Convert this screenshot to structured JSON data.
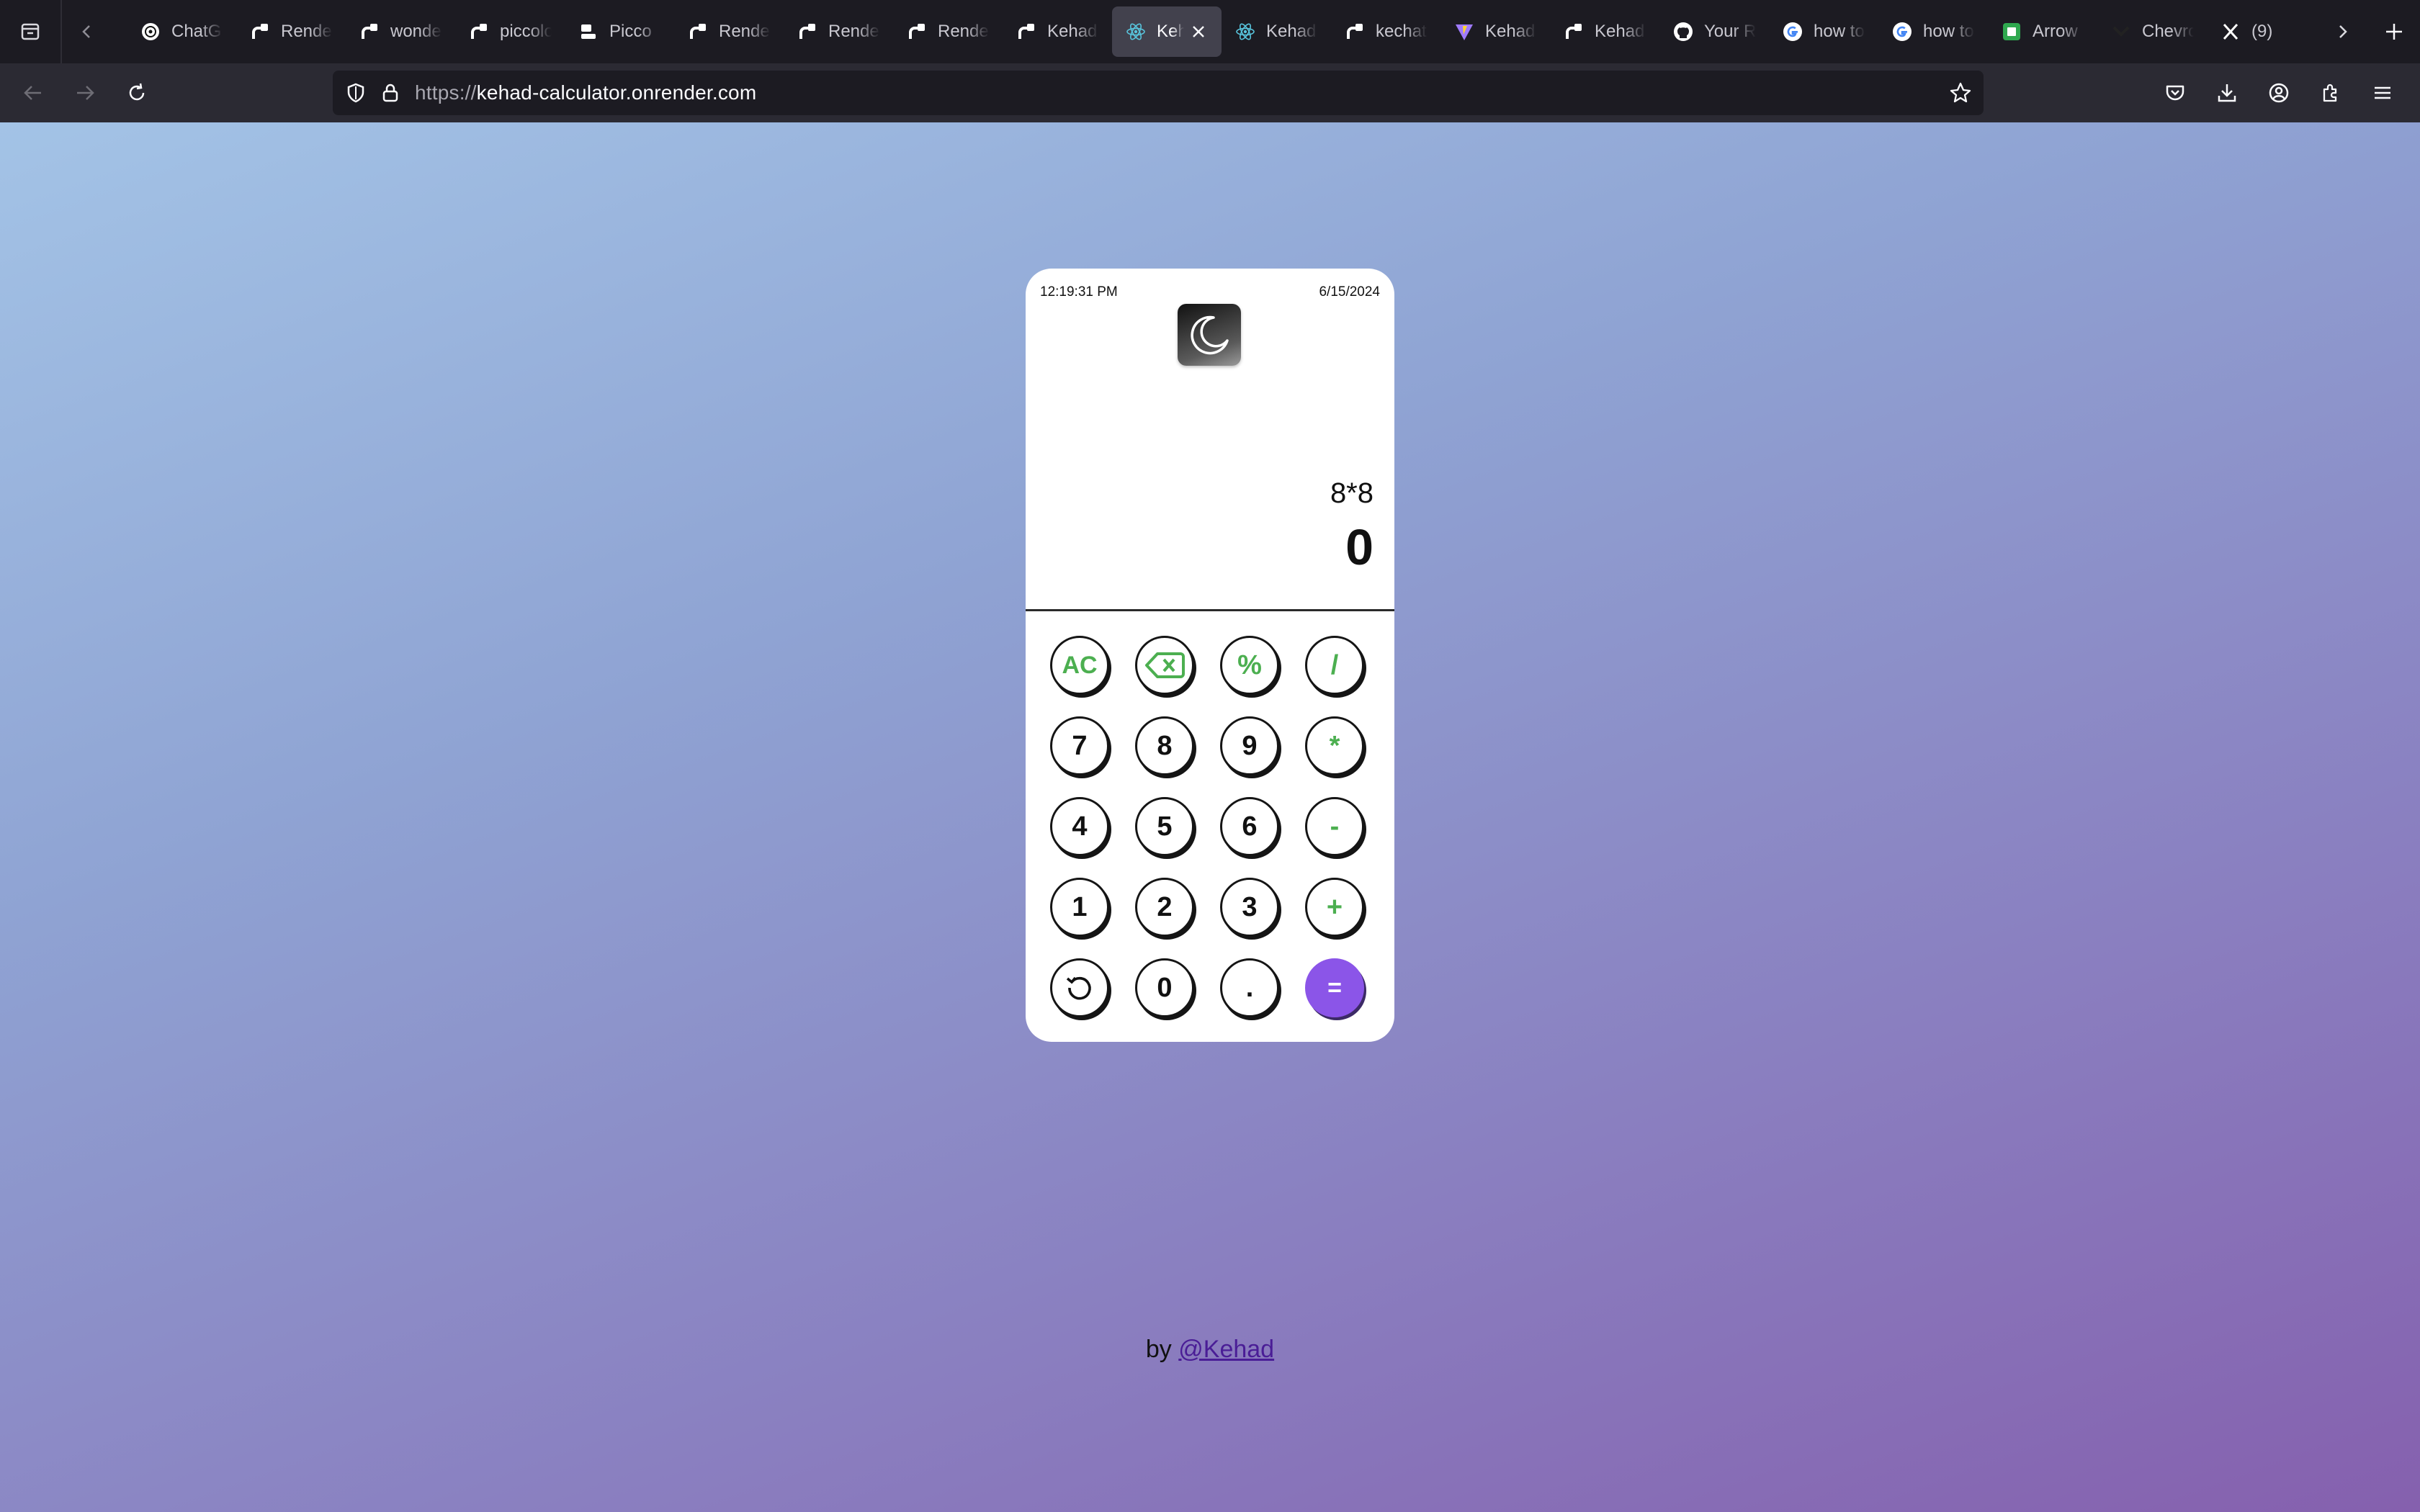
{
  "browser": {
    "tabs": [
      {
        "title": "ChatGPT",
        "icon": "openai-icon"
      },
      {
        "title": "Render",
        "icon": "render-icon"
      },
      {
        "title": "wonderful",
        "icon": "render-icon"
      },
      {
        "title": "piccolo",
        "icon": "render-icon"
      },
      {
        "title": "Picco",
        "icon": "picco-icon"
      },
      {
        "title": "Render",
        "icon": "render-icon"
      },
      {
        "title": "Render",
        "icon": "render-icon"
      },
      {
        "title": "Render",
        "icon": "render-icon"
      },
      {
        "title": "Kehad",
        "icon": "render-icon"
      },
      {
        "title": "Kehad",
        "icon": "react-icon",
        "active": true
      },
      {
        "title": "Kehad",
        "icon": "react-icon"
      },
      {
        "title": "kechat",
        "icon": "render-icon"
      },
      {
        "title": "Kehad",
        "icon": "vite-icon"
      },
      {
        "title": "Kehad",
        "icon": "render-icon"
      },
      {
        "title": "Your R",
        "icon": "github-icon"
      },
      {
        "title": "how to",
        "icon": "google-icon"
      },
      {
        "title": "how to",
        "icon": "google-icon"
      },
      {
        "title": "Arrow",
        "icon": "green-square-icon"
      },
      {
        "title": "Chevron",
        "icon": "vercel-icon"
      },
      {
        "title": "(9)",
        "icon": "x-icon"
      }
    ],
    "url_protocol": "https://",
    "url_host": "kehad-calculator.onrender.com"
  },
  "calculator": {
    "time": "12:19:31 PM",
    "date": "6/15/2024",
    "expression": "8*8",
    "result": "0",
    "keys": [
      [
        {
          "label": "AC",
          "type": "fn"
        },
        {
          "label": "",
          "type": "fn",
          "icon": "backspace-icon"
        },
        {
          "label": "%",
          "type": "fn"
        },
        {
          "label": "/",
          "type": "fn"
        }
      ],
      [
        {
          "label": "7"
        },
        {
          "label": "8"
        },
        {
          "label": "9"
        },
        {
          "label": "*",
          "type": "fn"
        }
      ],
      [
        {
          "label": "4"
        },
        {
          "label": "5"
        },
        {
          "label": "6"
        },
        {
          "label": "-",
          "type": "fn"
        }
      ],
      [
        {
          "label": "1"
        },
        {
          "label": "2"
        },
        {
          "label": "3"
        },
        {
          "label": "+",
          "type": "fn"
        }
      ],
      [
        {
          "label": "",
          "icon": "history-icon"
        },
        {
          "label": "0"
        },
        {
          "label": "."
        },
        {
          "label": "=",
          "type": "eq"
        }
      ]
    ],
    "accent_color": "#4caf50",
    "equals_color": "#8b55e8"
  },
  "footer": {
    "prefix": "by",
    "link_text": "@Kehad"
  }
}
